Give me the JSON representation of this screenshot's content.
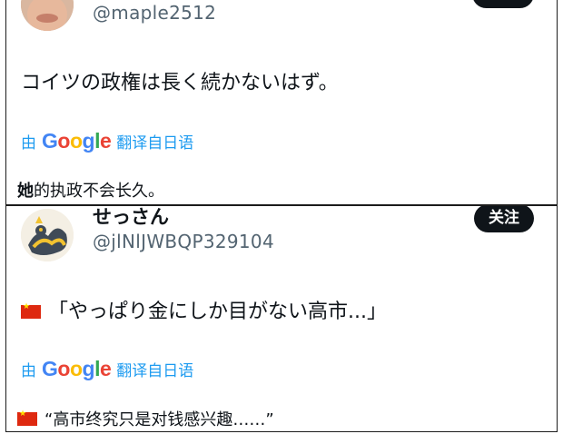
{
  "post1": {
    "handle": "@maple2512",
    "text": "コイツの政権は長く続かないはず。",
    "translate_prefix": "由",
    "translate_suffix": "翻译自日语",
    "translated_first": "她",
    "translated_rest": "的执政不会长久。"
  },
  "post2": {
    "display_name": "せっさん",
    "handle": "@jlNlJWBQP329104",
    "follow_label": "关注",
    "text": "「やっぱり金にしか目がない高市...」",
    "translate_prefix": "由",
    "translate_suffix": "翻译自日语",
    "translated_text": "“高市终究只是对钱感兴趣……”"
  },
  "google_logo": {
    "letters": [
      "G",
      "o",
      "o",
      "g",
      "l",
      "e"
    ]
  },
  "colors": {
    "accent": "#1d9bf0",
    "button_bg": "#0f1419",
    "handle": "#536471"
  },
  "icons": {
    "flag": "flag-china-icon"
  }
}
